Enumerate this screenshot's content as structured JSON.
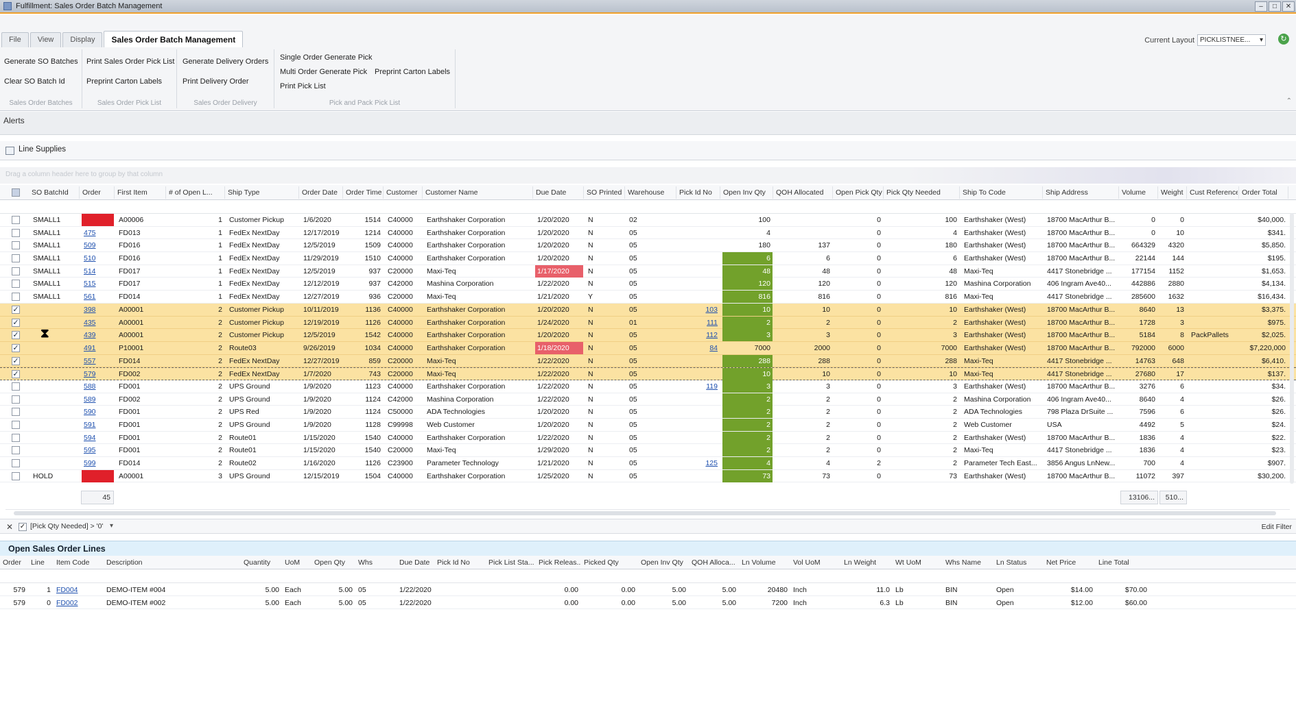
{
  "window": {
    "title": "Fulfillment: Sales Order Batch Management"
  },
  "tabs": [
    "File",
    "View",
    "Display",
    "Sales Order Batch Management"
  ],
  "layout": {
    "label": "Current Layout",
    "value": "PICKLISTNEE..."
  },
  "ribbon": {
    "groups": [
      {
        "label": "Sales Order Batches",
        "buttons": [
          "Generate SO Batches",
          "Clear SO Batch Id"
        ]
      },
      {
        "label": "Sales Order Pick List",
        "buttons": [
          "Print Sales Order Pick List",
          "Preprint Carton Labels"
        ]
      },
      {
        "label": "Sales Order Delivery",
        "buttons": [
          "Generate Delivery Orders",
          "Print Delivery Order"
        ]
      },
      {
        "label": "Pick and Pack Pick List",
        "buttons": [
          "Single Order Generate Pick",
          "Multi Order Generate Pick",
          "Print Pick List",
          "Preprint Carton Labels"
        ]
      }
    ]
  },
  "alerts": {
    "label": "Alerts"
  },
  "line_supplies": {
    "label": "Line Supplies"
  },
  "group_panel": {
    "hint": "Drag a column header here to group by that column"
  },
  "grid": {
    "columns": [
      "SO BatchId",
      "Order",
      "First Item",
      "# of Open L...",
      "Ship Type",
      "Order Date",
      "Order Time",
      "Customer",
      "Customer Name",
      "Due Date",
      "SO Printed",
      "Warehouse",
      "Pick Id No",
      "Open Inv Qty",
      "QOH Allocated",
      "Open Pick Qty",
      "Pick Qty Needed",
      "Ship To Code",
      "Ship Address",
      "Volume",
      "Weight",
      "Cust Reference",
      "Order Total"
    ],
    "rows": [
      {
        "checked": false,
        "batch": "SMALL1",
        "order": "",
        "item": "A00006",
        "open": "1",
        "ship": "Customer Pickup",
        "odate": "1/6/2020",
        "otime": "1514",
        "cust": "C40000",
        "cname": "Earthshaker Corporation",
        "due": "1/20/2020",
        "printed": "N",
        "wh": "02",
        "pick": "",
        "inv": "100",
        "qoh": "",
        "opick": "0",
        "need": "100",
        "shipto": "Earthshaker (West)",
        "addr": "18700 MacArthur B...",
        "vol": "0",
        "wt": "0",
        "ref": "",
        "total": "$40,000.",
        "style": "",
        "orderred": true,
        "duered": false,
        "invgreen": false
      },
      {
        "checked": false,
        "batch": "SMALL1",
        "order": "475",
        "item": "FD013",
        "open": "1",
        "ship": "FedEx NextDay",
        "odate": "12/17/2019",
        "otime": "1214",
        "cust": "C40000",
        "cname": "Earthshaker Corporation",
        "due": "1/20/2020",
        "printed": "N",
        "wh": "05",
        "pick": "",
        "inv": "4",
        "qoh": "",
        "opick": "0",
        "need": "4",
        "shipto": "Earthshaker (West)",
        "addr": "18700 MacArthur B...",
        "vol": "0",
        "wt": "10",
        "ref": "",
        "total": "$341.",
        "style": "",
        "orderred": false,
        "duered": false,
        "invgreen": false
      },
      {
        "checked": false,
        "batch": "SMALL1",
        "order": "509",
        "item": "FD016",
        "open": "1",
        "ship": "FedEx NextDay",
        "odate": "12/5/2019",
        "otime": "1509",
        "cust": "C40000",
        "cname": "Earthshaker Corporation",
        "due": "1/20/2020",
        "printed": "N",
        "wh": "05",
        "pick": "",
        "inv": "180",
        "qoh": "137",
        "opick": "0",
        "need": "180",
        "shipto": "Earthshaker (West)",
        "addr": "18700 MacArthur B...",
        "vol": "664329",
        "wt": "4320",
        "ref": "",
        "total": "$5,850.",
        "style": "",
        "orderred": false,
        "duered": false,
        "invgreen": false
      },
      {
        "checked": false,
        "batch": "SMALL1",
        "order": "510",
        "item": "FD016",
        "open": "1",
        "ship": "FedEx NextDay",
        "odate": "11/29/2019",
        "otime": "1510",
        "cust": "C40000",
        "cname": "Earthshaker Corporation",
        "due": "1/20/2020",
        "printed": "N",
        "wh": "05",
        "pick": "",
        "inv": "6",
        "qoh": "6",
        "opick": "0",
        "need": "6",
        "shipto": "Earthshaker (West)",
        "addr": "18700 MacArthur B...",
        "vol": "22144",
        "wt": "144",
        "ref": "",
        "total": "$195.",
        "style": "",
        "orderred": false,
        "duered": false,
        "invgreen": true
      },
      {
        "checked": false,
        "batch": "SMALL1",
        "order": "514",
        "item": "FD017",
        "open": "1",
        "ship": "FedEx NextDay",
        "odate": "12/5/2019",
        "otime": "937",
        "cust": "C20000",
        "cname": "Maxi-Teq",
        "due": "1/17/2020",
        "printed": "N",
        "wh": "05",
        "pick": "",
        "inv": "48",
        "qoh": "48",
        "opick": "0",
        "need": "48",
        "shipto": "Maxi-Teq",
        "addr": "4417 Stonebridge ...",
        "vol": "177154",
        "wt": "1152",
        "ref": "",
        "total": "$1,653.",
        "style": "",
        "orderred": false,
        "duered": true,
        "invgreen": true
      },
      {
        "checked": false,
        "batch": "SMALL1",
        "order": "515",
        "item": "FD017",
        "open": "1",
        "ship": "FedEx NextDay",
        "odate": "12/12/2019",
        "otime": "937",
        "cust": "C42000",
        "cname": "Mashina Corporation",
        "due": "1/22/2020",
        "printed": "N",
        "wh": "05",
        "pick": "",
        "inv": "120",
        "qoh": "120",
        "opick": "0",
        "need": "120",
        "shipto": "Mashina Corporation",
        "addr": "406 Ingram Ave40...",
        "vol": "442886",
        "wt": "2880",
        "ref": "",
        "total": "$4,134.",
        "style": "",
        "orderred": false,
        "duered": false,
        "invgreen": true
      },
      {
        "checked": false,
        "batch": "SMALL1",
        "order": "561",
        "item": "FD014",
        "open": "1",
        "ship": "FedEx NextDay",
        "odate": "12/27/2019",
        "otime": "936",
        "cust": "C20000",
        "cname": "Maxi-Teq",
        "due": "1/21/2020",
        "printed": "Y",
        "wh": "05",
        "pick": "",
        "inv": "816",
        "qoh": "816",
        "opick": "0",
        "need": "816",
        "shipto": "Maxi-Teq",
        "addr": "4417 Stonebridge ...",
        "vol": "285600",
        "wt": "1632",
        "ref": "",
        "total": "$16,434.",
        "style": "",
        "orderred": false,
        "duered": false,
        "invgreen": true
      },
      {
        "checked": true,
        "batch": "",
        "order": "398",
        "item": "A00001",
        "open": "2",
        "ship": "Customer Pickup",
        "odate": "10/11/2019",
        "otime": "1136",
        "cust": "C40000",
        "cname": "Earthshaker Corporation",
        "due": "1/20/2020",
        "printed": "N",
        "wh": "05",
        "pick": "103",
        "inv": "10",
        "qoh": "10",
        "opick": "0",
        "need": "10",
        "shipto": "Earthshaker (West)",
        "addr": "18700 MacArthur B...",
        "vol": "8640",
        "wt": "13",
        "ref": "",
        "total": "$3,375.",
        "style": "sel",
        "orderred": false,
        "duered": false,
        "invgreen": true
      },
      {
        "checked": true,
        "batch": "",
        "order": "435",
        "item": "A00001",
        "open": "2",
        "ship": "Customer Pickup",
        "odate": "12/19/2019",
        "otime": "1126",
        "cust": "C40000",
        "cname": "Earthshaker Corporation",
        "due": "1/24/2020",
        "printed": "N",
        "wh": "01",
        "pick": "111",
        "inv": "2",
        "qoh": "2",
        "opick": "0",
        "need": "2",
        "shipto": "Earthshaker (West)",
        "addr": "18700 MacArthur B...",
        "vol": "1728",
        "wt": "3",
        "ref": "",
        "total": "$975.",
        "style": "sel",
        "orderred": false,
        "duered": false,
        "invgreen": true
      },
      {
        "checked": true,
        "batch": "",
        "order": "439",
        "item": "A00001",
        "open": "2",
        "ship": "Customer Pickup",
        "odate": "12/5/2019",
        "otime": "1542",
        "cust": "C40000",
        "cname": "Earthshaker Corporation",
        "due": "1/20/2020",
        "printed": "N",
        "wh": "05",
        "pick": "112",
        "inv": "3",
        "qoh": "3",
        "opick": "0",
        "need": "3",
        "shipto": "Earthshaker (West)",
        "addr": "18700 MacArthur B...",
        "vol": "5184",
        "wt": "8",
        "ref": "PackPallets",
        "total": "$2,025.",
        "style": "sel",
        "orderred": false,
        "duered": false,
        "invgreen": true
      },
      {
        "checked": true,
        "batch": "",
        "order": "491",
        "item": "P10001",
        "open": "2",
        "ship": "Route03",
        "odate": "9/26/2019",
        "otime": "1034",
        "cust": "C40000",
        "cname": "Earthshaker Corporation",
        "due": "1/18/2020",
        "printed": "N",
        "wh": "05",
        "pick": "84",
        "inv": "7000",
        "qoh": "2000",
        "opick": "0",
        "need": "7000",
        "shipto": "Earthshaker (West)",
        "addr": "18700 MacArthur B...",
        "vol": "792000",
        "wt": "6000",
        "ref": "",
        "total": "$7,220,000",
        "style": "sel",
        "orderred": false,
        "duered": true,
        "invgreen": false
      },
      {
        "checked": true,
        "batch": "",
        "order": "557",
        "item": "FD014",
        "open": "2",
        "ship": "FedEx NextDay",
        "odate": "12/27/2019",
        "otime": "859",
        "cust": "C20000",
        "cname": "Maxi-Teq",
        "due": "1/22/2020",
        "printed": "N",
        "wh": "05",
        "pick": "",
        "inv": "288",
        "qoh": "288",
        "opick": "0",
        "need": "288",
        "shipto": "Maxi-Teq",
        "addr": "4417 Stonebridge ...",
        "vol": "14763",
        "wt": "648",
        "ref": "",
        "total": "$6,410.",
        "style": "sel",
        "orderred": false,
        "duered": false,
        "invgreen": true
      },
      {
        "checked": true,
        "batch": "",
        "order": "579",
        "item": "FD002",
        "open": "2",
        "ship": "FedEx NextDay",
        "odate": "1/7/2020",
        "otime": "743",
        "cust": "C20000",
        "cname": "Maxi-Teq",
        "due": "1/22/2020",
        "printed": "N",
        "wh": "05",
        "pick": "",
        "inv": "10",
        "qoh": "10",
        "opick": "0",
        "need": "10",
        "shipto": "Maxi-Teq",
        "addr": "4417 Stonebridge ...",
        "vol": "27680",
        "wt": "17",
        "ref": "",
        "total": "$137.",
        "style": "focus",
        "orderred": false,
        "duered": false,
        "invgreen": true
      },
      {
        "checked": false,
        "batch": "",
        "order": "588",
        "item": "FD001",
        "open": "2",
        "ship": "UPS Ground",
        "odate": "1/9/2020",
        "otime": "1123",
        "cust": "C40000",
        "cname": "Earthshaker Corporation",
        "due": "1/22/2020",
        "printed": "N",
        "wh": "05",
        "pick": "119",
        "inv": "3",
        "qoh": "3",
        "opick": "0",
        "need": "3",
        "shipto": "Earthshaker (West)",
        "addr": "18700 MacArthur B...",
        "vol": "3276",
        "wt": "6",
        "ref": "",
        "total": "$34.",
        "style": "",
        "orderred": false,
        "duered": false,
        "invgreen": true
      },
      {
        "checked": false,
        "batch": "",
        "order": "589",
        "item": "FD002",
        "open": "2",
        "ship": "UPS Ground",
        "odate": "1/9/2020",
        "otime": "1124",
        "cust": "C42000",
        "cname": "Mashina Corporation",
        "due": "1/22/2020",
        "printed": "N",
        "wh": "05",
        "pick": "",
        "inv": "2",
        "qoh": "2",
        "opick": "0",
        "need": "2",
        "shipto": "Mashina Corporation",
        "addr": "406 Ingram Ave40...",
        "vol": "8640",
        "wt": "4",
        "ref": "",
        "total": "$26.",
        "style": "",
        "orderred": false,
        "duered": false,
        "invgreen": true
      },
      {
        "checked": false,
        "batch": "",
        "order": "590",
        "item": "FD001",
        "open": "2",
        "ship": "UPS Red",
        "odate": "1/9/2020",
        "otime": "1124",
        "cust": "C50000",
        "cname": "ADA Technologies",
        "due": "1/20/2020",
        "printed": "N",
        "wh": "05",
        "pick": "",
        "inv": "2",
        "qoh": "2",
        "opick": "0",
        "need": "2",
        "shipto": "ADA Technologies",
        "addr": "798 Plaza DrSuite ...",
        "vol": "7596",
        "wt": "6",
        "ref": "",
        "total": "$26.",
        "style": "",
        "orderred": false,
        "duered": false,
        "invgreen": true
      },
      {
        "checked": false,
        "batch": "",
        "order": "591",
        "item": "FD001",
        "open": "2",
        "ship": "UPS Ground",
        "odate": "1/9/2020",
        "otime": "1128",
        "cust": "C99998",
        "cname": "Web Customer",
        "due": "1/20/2020",
        "printed": "N",
        "wh": "05",
        "pick": "",
        "inv": "2",
        "qoh": "2",
        "opick": "0",
        "need": "2",
        "shipto": "Web Customer",
        "addr": "USA",
        "vol": "4492",
        "wt": "5",
        "ref": "",
        "total": "$24.",
        "style": "",
        "orderred": false,
        "duered": false,
        "invgreen": true
      },
      {
        "checked": false,
        "batch": "",
        "order": "594",
        "item": "FD001",
        "open": "2",
        "ship": "Route01",
        "odate": "1/15/2020",
        "otime": "1540",
        "cust": "C40000",
        "cname": "Earthshaker Corporation",
        "due": "1/22/2020",
        "printed": "N",
        "wh": "05",
        "pick": "",
        "inv": "2",
        "qoh": "2",
        "opick": "0",
        "need": "2",
        "shipto": "Earthshaker (West)",
        "addr": "18700 MacArthur B...",
        "vol": "1836",
        "wt": "4",
        "ref": "",
        "total": "$22.",
        "style": "",
        "orderred": false,
        "duered": false,
        "invgreen": true
      },
      {
        "checked": false,
        "batch": "",
        "order": "595",
        "item": "FD001",
        "open": "2",
        "ship": "Route01",
        "odate": "1/15/2020",
        "otime": "1540",
        "cust": "C20000",
        "cname": "Maxi-Teq",
        "due": "1/29/2020",
        "printed": "N",
        "wh": "05",
        "pick": "",
        "inv": "2",
        "qoh": "2",
        "opick": "0",
        "need": "2",
        "shipto": "Maxi-Teq",
        "addr": "4417 Stonebridge ...",
        "vol": "1836",
        "wt": "4",
        "ref": "",
        "total": "$23.",
        "style": "",
        "orderred": false,
        "duered": false,
        "invgreen": true
      },
      {
        "checked": false,
        "batch": "",
        "order": "599",
        "item": "FD014",
        "open": "2",
        "ship": "Route02",
        "odate": "1/16/2020",
        "otime": "1126",
        "cust": "C23900",
        "cname": "Parameter Technology",
        "due": "1/21/2020",
        "printed": "N",
        "wh": "05",
        "pick": "125",
        "inv": "4",
        "qoh": "4",
        "opick": "2",
        "need": "2",
        "shipto": "Parameter Tech East...",
        "addr": "3856 Angus LnNew...",
        "vol": "700",
        "wt": "4",
        "ref": "",
        "total": "$907.",
        "style": "",
        "orderred": false,
        "duered": false,
        "invgreen": true
      },
      {
        "checked": false,
        "batch": "HOLD",
        "order": "",
        "item": "A00001",
        "open": "3",
        "ship": "UPS Ground",
        "odate": "12/15/2019",
        "otime": "1504",
        "cust": "C40000",
        "cname": "Earthshaker Corporation",
        "due": "1/25/2020",
        "printed": "N",
        "wh": "05",
        "pick": "",
        "inv": "73",
        "qoh": "73",
        "opick": "0",
        "need": "73",
        "shipto": "Earthshaker (West)",
        "addr": "18700 MacArthur B...",
        "vol": "11072",
        "wt": "397",
        "ref": "",
        "total": "$30,200.",
        "style": "",
        "orderred": true,
        "duered": false,
        "invgreen": true
      }
    ],
    "summary": {
      "order_count": "45",
      "volume_total": "13106...",
      "weight_total": "510..."
    }
  },
  "filter": {
    "text": "[Pick Qty Needed] > '0'",
    "edit_label": "Edit Filter"
  },
  "open_lines": {
    "title": "Open Sales Order Lines",
    "columns": [
      "Order",
      "Line",
      "Item Code",
      "Description",
      "Quantity",
      "UoM",
      "Open Qty",
      "Whs",
      "Due Date",
      "Pick Id No",
      "Pick List Sta...",
      "Pick Releas...",
      "Picked Qty",
      "Open Inv Qty",
      "QOH Alloca...",
      "Ln Volume",
      "Vol UoM",
      "Ln Weight",
      "Wt UoM",
      "Whs Name",
      "Ln Status",
      "Net Price",
      "Line Total"
    ],
    "rows": [
      {
        "order": "579",
        "line": "1",
        "item": "FD004",
        "desc": "DEMO-ITEM #004",
        "qty": "5.00",
        "uom": "Each",
        "openqty": "5.00",
        "whs": "05",
        "due": "1/22/2020",
        "pickid": "",
        "pls": "",
        "prel": "0.00",
        "picked": "0.00",
        "inv": "5.00",
        "qoh": "5.00",
        "vol": "20480",
        "voluom": "Inch",
        "weight": "11.0",
        "wtuom": "Lb",
        "whsname": "BIN",
        "status": "Open",
        "price": "$14.00",
        "total": "$70.00"
      },
      {
        "order": "579",
        "line": "0",
        "item": "FD002",
        "desc": "DEMO-ITEM #002",
        "qty": "5.00",
        "uom": "Each",
        "openqty": "5.00",
        "whs": "05",
        "due": "1/22/2020",
        "pickid": "",
        "pls": "",
        "prel": "0.00",
        "picked": "0.00",
        "inv": "5.00",
        "qoh": "5.00",
        "vol": "7200",
        "voluom": "Inch",
        "weight": "6.3",
        "wtuom": "Lb",
        "whsname": "BIN",
        "status": "Open",
        "price": "$12.00",
        "total": "$60.00"
      }
    ]
  },
  "colors": {
    "selected_row": "#fbe2a2",
    "green_cell": "#72a12b",
    "red_cell": "#e0202a",
    "overdue": "#e8606a",
    "accent": "#f0a02a"
  }
}
